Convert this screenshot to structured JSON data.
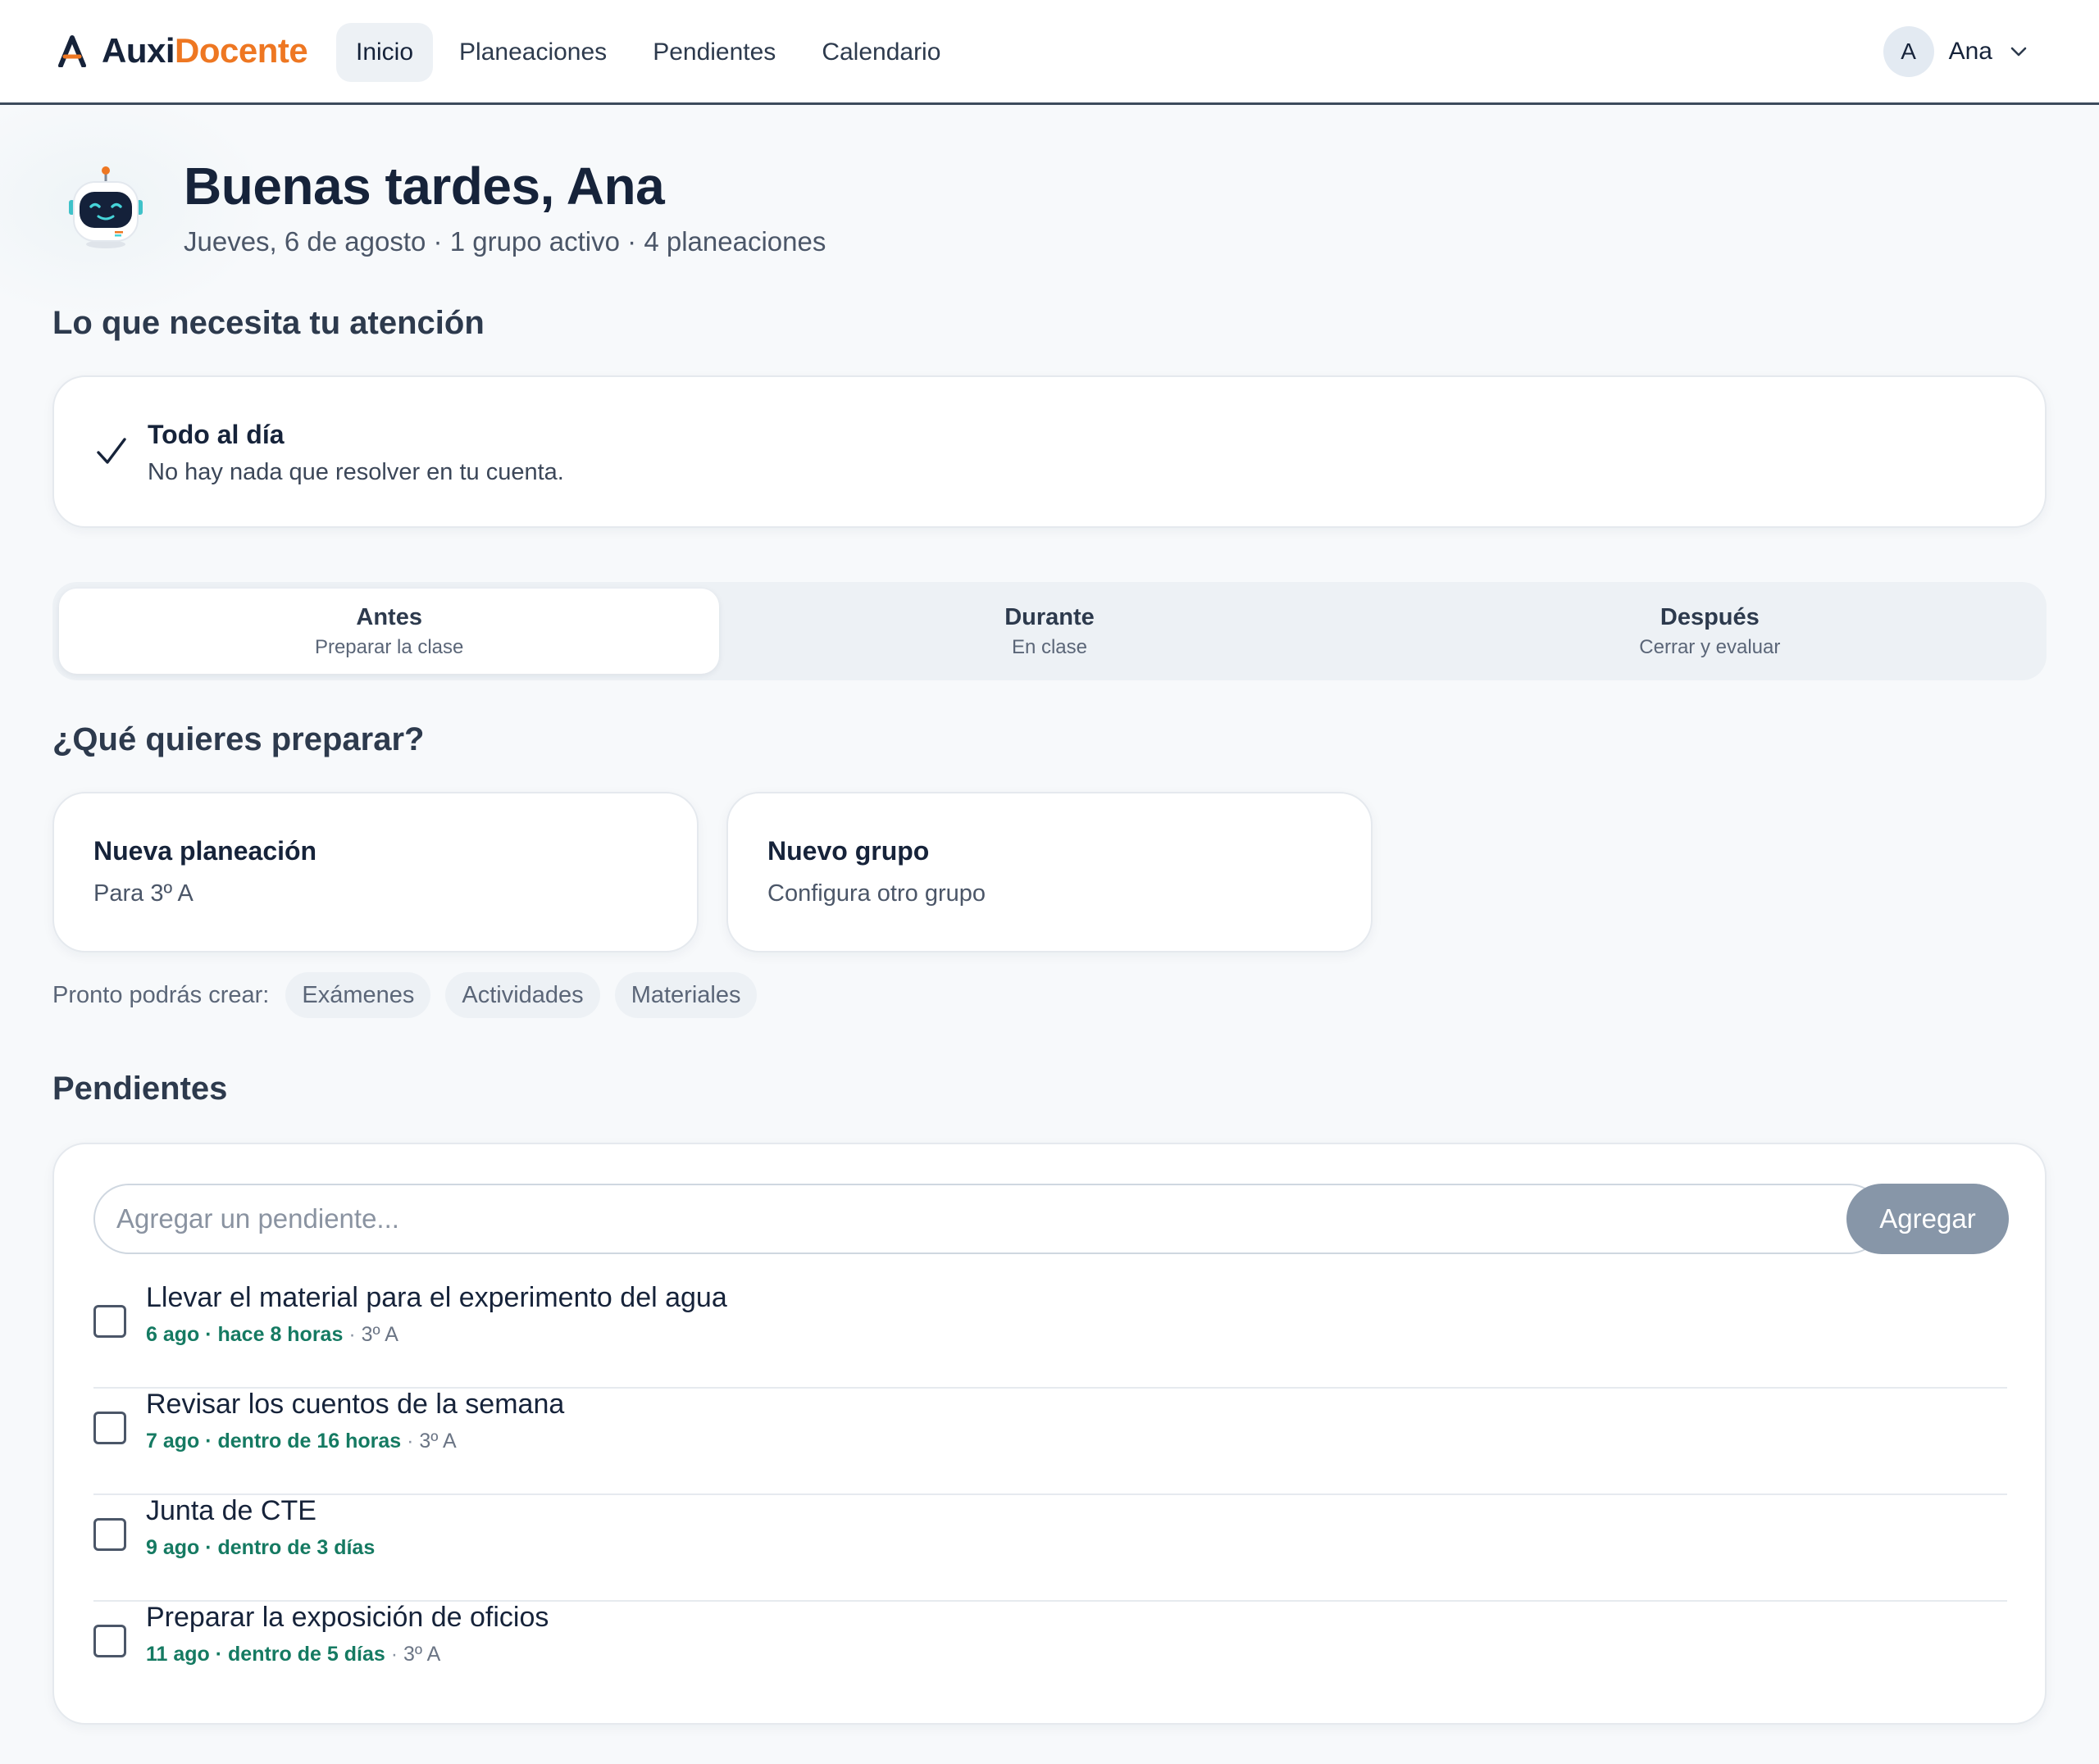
{
  "brand": {
    "part1": "Auxi",
    "part2": "Docente"
  },
  "nav": {
    "items": [
      {
        "label": "Inicio",
        "active": true
      },
      {
        "label": "Planeaciones",
        "active": false
      },
      {
        "label": "Pendientes",
        "active": false
      },
      {
        "label": "Calendario",
        "active": false
      }
    ]
  },
  "user": {
    "initial": "A",
    "name": "Ana"
  },
  "greeting": {
    "title": "Buenas tardes, Ana",
    "subtitle": "Jueves, 6 de agosto · 1 grupo activo · 4 planeaciones"
  },
  "attention": {
    "heading": "Lo que necesita tu atención",
    "title": "Todo al día",
    "text": "No hay nada que resolver en tu cuenta."
  },
  "tabs": [
    {
      "label": "Antes",
      "sub": "Preparar la clase",
      "active": true
    },
    {
      "label": "Durante",
      "sub": "En clase",
      "active": false
    },
    {
      "label": "Después",
      "sub": "Cerrar y evaluar",
      "active": false
    }
  ],
  "prepare": {
    "heading": "¿Qué quieres preparar?",
    "cards": [
      {
        "title": "Nueva planeación",
        "sub": "Para 3º A"
      },
      {
        "title": "Nuevo grupo",
        "sub": "Configura otro grupo"
      }
    ],
    "soon_label": "Pronto podrás crear:",
    "soon_chips": [
      "Exámenes",
      "Actividades",
      "Materiales"
    ]
  },
  "pendientes": {
    "heading": "Pendientes",
    "input_placeholder": "Agregar un pendiente...",
    "add_label": "Agregar",
    "items": [
      {
        "title": "Llevar el material para el experimento del agua",
        "date": "6 ago · hace 8 horas",
        "group": "3º A"
      },
      {
        "title": "Revisar los cuentos de la semana",
        "date": "7 ago · dentro de 16 horas",
        "group": "3º A"
      },
      {
        "title": "Junta de CTE",
        "date": "9 ago · dentro de 3 días",
        "group": ""
      },
      {
        "title": "Preparar la exposición de oficios",
        "date": "11 ago · dentro de 5 días",
        "group": "3º A"
      }
    ],
    "group_separator": " · "
  },
  "colors": {
    "brand_dark": "#16233a",
    "brand_orange": "#ee7722",
    "date_green": "#157a62",
    "button_gray": "#8796a8"
  }
}
